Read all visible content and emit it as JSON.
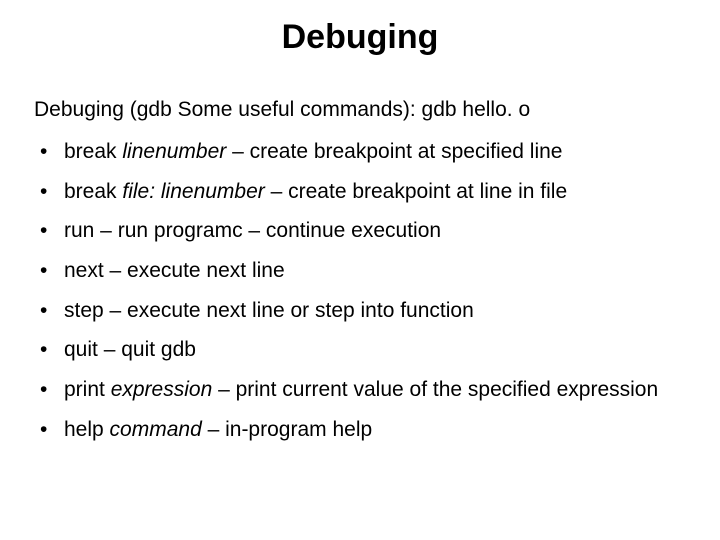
{
  "title": "Debuging",
  "intro": "Debuging (gdb Some useful commands): gdb hello. o",
  "items": [
    {
      "pre": "break ",
      "em": "linenumber",
      "post": " – create breakpoint at specified line"
    },
    {
      "pre": "break ",
      "em": "file: linenumber",
      "post": " – create breakpoint at line in file"
    },
    {
      "pre": "run – run programc – continue execution",
      "em": "",
      "post": ""
    },
    {
      "pre": "next – execute next line",
      "em": "",
      "post": ""
    },
    {
      "pre": "step – execute next line or step into function",
      "em": "",
      "post": ""
    },
    {
      "pre": "quit – quit gdb",
      "em": "",
      "post": ""
    },
    {
      "pre": "print ",
      "em": "expression",
      "post": " – print current value of the specified expression"
    },
    {
      "pre": "help ",
      "em": "command",
      "post": " – in-program help"
    }
  ]
}
